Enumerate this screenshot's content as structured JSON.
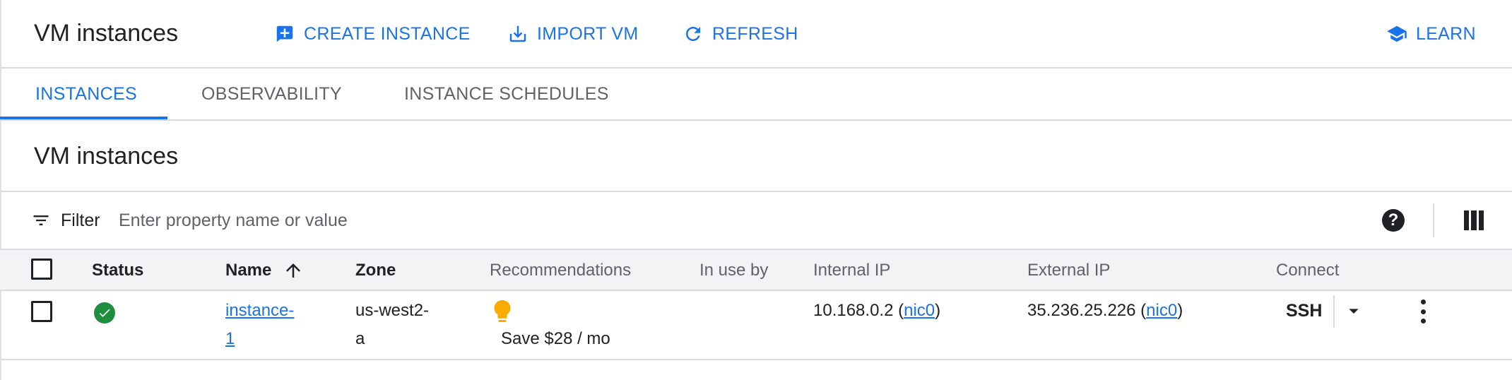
{
  "header": {
    "title": "VM instances",
    "create_label": "CREATE INSTANCE",
    "import_label": "IMPORT VM",
    "refresh_label": "REFRESH",
    "learn_label": "LEARN"
  },
  "tabs": [
    {
      "label": "INSTANCES",
      "active": true
    },
    {
      "label": "OBSERVABILITY",
      "active": false
    },
    {
      "label": "INSTANCE SCHEDULES",
      "active": false
    }
  ],
  "section": {
    "title": "VM instances"
  },
  "filter": {
    "label": "Filter",
    "placeholder": "Enter property name or value",
    "help_glyph": "?"
  },
  "table": {
    "columns": {
      "status": "Status",
      "name": "Name",
      "zone": "Zone",
      "recommendations": "Recommendations",
      "in_use_by": "In use by",
      "internal_ip": "Internal IP",
      "external_ip": "External IP",
      "connect": "Connect"
    },
    "sort": {
      "column": "Name",
      "direction": "ascending"
    },
    "rows": [
      {
        "status": "running",
        "name_line1": "instance-",
        "name_line2": "1",
        "zone_line1": "us-west2-",
        "zone_line2": "a",
        "recommendation": "Save $28 / mo",
        "in_use_by": "",
        "internal_ip": "10.168.0.2",
        "internal_nic": "nic0",
        "external_ip": "35.236.25.226",
        "external_nic": "nic0",
        "connect_label": "SSH"
      }
    ]
  },
  "colors": {
    "accent": "#1a73e8",
    "status_ok": "#1e8e3e",
    "recommendation_bulb": "#f9ab00",
    "text": "#202124",
    "muted": "#5f6368"
  },
  "icons": {
    "create": "add-box-icon",
    "import": "download-icon",
    "refresh": "refresh-icon",
    "learn": "school-icon",
    "filter": "filter-list-icon",
    "help": "help-icon",
    "columns": "column-display-icon",
    "status": "check-circle-icon",
    "recommendation": "lightbulb-icon",
    "sort": "arrow-up-icon",
    "ssh_dropdown": "arrow-drop-down-icon",
    "row_menu": "more-vert-icon"
  }
}
